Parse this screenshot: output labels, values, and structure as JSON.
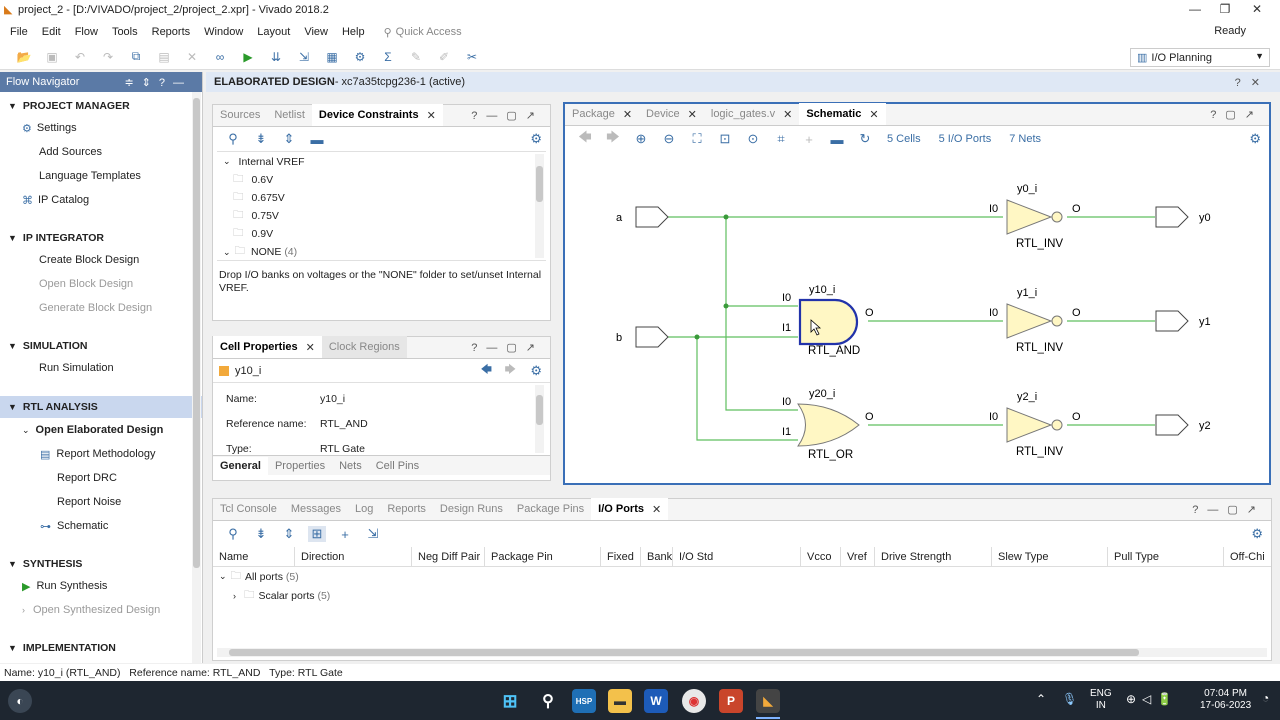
{
  "window": {
    "title": "project_2 - [D:/VIVADO/project_2/project_2.xpr] - Vivado 2018.2",
    "status": "Ready"
  },
  "menu": [
    "File",
    "Edit",
    "Flow",
    "Tools",
    "Reports",
    "Window",
    "Layout",
    "View",
    "Help"
  ],
  "quick_access_placeholder": "Quick Access",
  "layout_select": "I/O Planning",
  "flow_nav": {
    "title": "Flow Navigator",
    "sections": [
      {
        "label": "PROJECT MANAGER",
        "items": [
          "Settings",
          "Add Sources",
          "Language Templates",
          "IP Catalog"
        ]
      },
      {
        "label": "IP INTEGRATOR",
        "items": [
          "Create Block Design",
          "Open Block Design",
          "Generate Block Design"
        ]
      },
      {
        "label": "SIMULATION",
        "items": [
          "Run Simulation"
        ]
      },
      {
        "label": "RTL ANALYSIS",
        "items": [
          "Open Elaborated Design",
          "Report Methodology",
          "Report DRC",
          "Report Noise",
          "Schematic"
        ]
      },
      {
        "label": "SYNTHESIS",
        "items": [
          "Run Synthesis",
          "Open Synthesized Design"
        ]
      },
      {
        "label": "IMPLEMENTATION",
        "items": []
      }
    ]
  },
  "editor_header": {
    "title": "ELABORATED DESIGN",
    "device": " - xc7a35tcpg236-1",
    "state": "(active)"
  },
  "constraints": {
    "tabs": [
      "Sources",
      "Netlist",
      "Device Constraints"
    ],
    "root": "Internal VREF",
    "items": [
      "0.6V",
      "0.675V",
      "0.75V",
      "0.9V"
    ],
    "none_label": "NONE",
    "none_count": "(4)",
    "hint": "Drop I/O banks on voltages or the \"NONE\" folder to set/unset Internal VREF."
  },
  "cell_props": {
    "tabs": [
      "Cell Properties",
      "Clock Regions"
    ],
    "cell": "y10_i",
    "rows": [
      {
        "k": "Name:",
        "v": "y10_i"
      },
      {
        "k": "Reference name:",
        "v": "RTL_AND"
      },
      {
        "k": "Type:",
        "v": "RTL Gate"
      }
    ],
    "bottom_tabs": [
      "General",
      "Properties",
      "Nets",
      "Cell Pins"
    ]
  },
  "schematic": {
    "tabs": [
      "Package",
      "Device",
      "logic_gates.v",
      "Schematic"
    ],
    "counts": [
      "5 Cells",
      "5 I/O Ports",
      "7 Nets"
    ],
    "inputs": [
      "a",
      "b"
    ],
    "outputs": [
      "y0",
      "y1",
      "y2"
    ],
    "cells": [
      {
        "inst": "y0_i",
        "ref": "RTL_INV",
        "pin_in": "I0",
        "pin_out": "O"
      },
      {
        "inst": "y10_i",
        "ref": "RTL_AND",
        "pin_in": "I0",
        "pin_in2": "I1",
        "pin_out": "O"
      },
      {
        "inst": "y1_i",
        "ref": "RTL_INV",
        "pin_in": "I0",
        "pin_out": "O"
      },
      {
        "inst": "y20_i",
        "ref": "RTL_OR",
        "pin_in": "I0",
        "pin_in2": "I1",
        "pin_out": "O"
      },
      {
        "inst": "y2_i",
        "ref": "RTL_INV",
        "pin_in": "I0",
        "pin_out": "O"
      }
    ]
  },
  "bottom": {
    "tabs": [
      "Tcl Console",
      "Messages",
      "Log",
      "Reports",
      "Design Runs",
      "Package Pins",
      "I/O Ports"
    ],
    "columns": [
      "Name",
      "Direction",
      "Neg Diff Pair",
      "Package Pin",
      "Fixed",
      "Bank",
      "I/O Std",
      "Vcco",
      "Vref",
      "Drive Strength",
      "Slew Type",
      "Pull Type",
      "Off-Chi"
    ],
    "rows": [
      {
        "label": "All ports",
        "count": "(5)"
      },
      {
        "label": "Scalar ports",
        "count": "(5)"
      }
    ]
  },
  "statusbar": {
    "name": "Name: y10_i (RTL_AND)",
    "ref": "Reference name: RTL_AND",
    "type": "Type: RTL Gate"
  },
  "taskbar": {
    "lang": "ENG",
    "region": "IN",
    "time": "07:04 PM",
    "date": "17-06-2023"
  }
}
